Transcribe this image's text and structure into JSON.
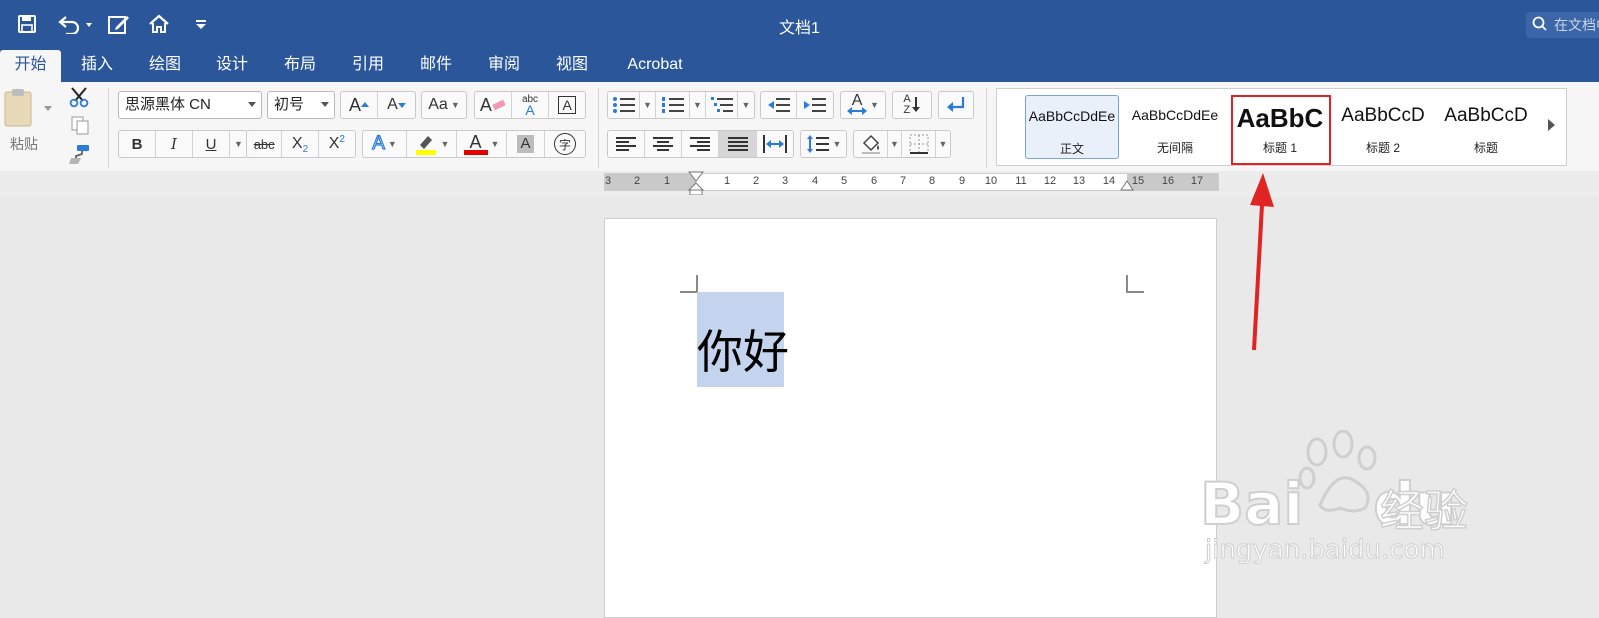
{
  "title_bar": {
    "document_title": "文档1",
    "search_placeholder": "在文档中搜索"
  },
  "tabs": [
    {
      "label": "开始",
      "active": true
    },
    {
      "label": "插入"
    },
    {
      "label": "绘图"
    },
    {
      "label": "设计"
    },
    {
      "label": "布局"
    },
    {
      "label": "引用"
    },
    {
      "label": "邮件"
    },
    {
      "label": "审阅"
    },
    {
      "label": "视图"
    },
    {
      "label": "Acrobat"
    }
  ],
  "clipboard": {
    "paste_label": "粘贴"
  },
  "font": {
    "family": "思源黑体 CN",
    "size": "初号",
    "bold": "B",
    "italic": "I",
    "underline": "U",
    "strikethrough": "abc",
    "subscript": "X",
    "subscript_mark": "2",
    "superscript": "X",
    "superscript_mark": "2",
    "grow_glyph": "A",
    "shrink_glyph": "A",
    "case_glyph": "Aa",
    "clear_glyph": "A",
    "phonetic_top": "abc",
    "phonetic_bottom": "A",
    "border_glyph": "A",
    "effects_glyph": "A",
    "color_glyph": "A",
    "shading_glyph": "A",
    "enclose_glyph": "字",
    "highlight_color": "#ffff00",
    "font_color": "#e00000"
  },
  "paragraph": {
    "sort_glyph_top": "A",
    "sort_glyph_bottom": "Z",
    "sort_glyph": "A"
  },
  "styles": [
    {
      "preview": "AaBbCcDdEe",
      "name": "正文",
      "selected": true
    },
    {
      "preview": "AaBbCcDdEe",
      "name": "无间隔"
    },
    {
      "preview": "AaBbC",
      "name": "标题 1",
      "highlighted": true
    },
    {
      "preview": "AaBbCcD",
      "name": "标题 2"
    },
    {
      "preview": "AaBbCcD",
      "name": "标题"
    }
  ],
  "ruler": {
    "labels": [
      "3",
      "2",
      "1",
      "1",
      "2",
      "3",
      "4",
      "5",
      "6",
      "7",
      "8",
      "9",
      "10",
      "11",
      "12",
      "13",
      "14",
      "15",
      "16",
      "17"
    ]
  },
  "document": {
    "text": "你好"
  },
  "watermark": {
    "brand": "Bai",
    "brand2": "du",
    "site_cn": "经验",
    "url": "jingyan.baidu.com"
  },
  "colors": {
    "accent": "#2b579a",
    "annotation_red": "#e02424",
    "selection": "#c5d4ee"
  }
}
